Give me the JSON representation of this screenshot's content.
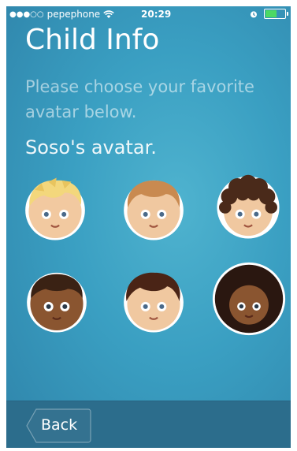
{
  "status_bar": {
    "signal": "●●●○○",
    "carrier": "pepephone",
    "time": "20:29"
  },
  "header": {
    "title": "Child Info",
    "subtitle": "Please choose your favorite avatar below."
  },
  "avatars": {
    "label": "Soso's avatar.",
    "options": [
      {
        "name": "blond-hair-boy"
      },
      {
        "name": "light-brown-hair-boy"
      },
      {
        "name": "curly-dark-hair-boy"
      },
      {
        "name": "dark-skin-short-hair-boy"
      },
      {
        "name": "dark-brown-hair-boy"
      },
      {
        "name": "afro-hair-boy"
      }
    ]
  },
  "nav": {
    "back_label": "Back"
  },
  "colors": {
    "background": "#3a9fc2",
    "bottom_bar": "#2c6d8c"
  }
}
